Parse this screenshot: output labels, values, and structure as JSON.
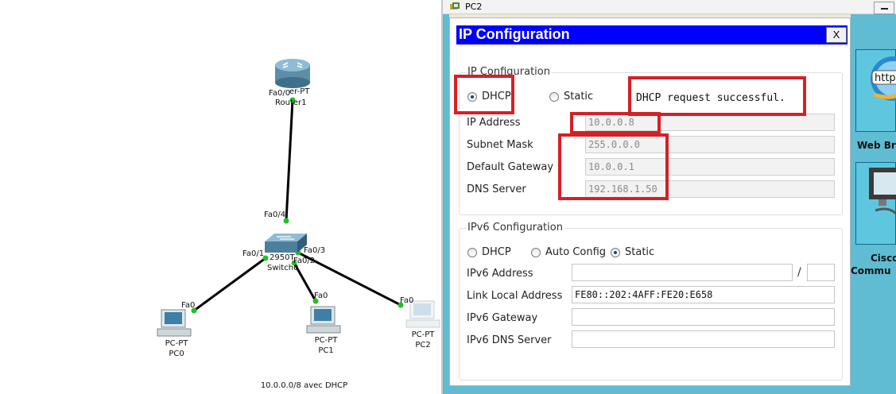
{
  "topology": {
    "caption": "10.0.0.0/8 avec DHCP",
    "router": {
      "model": "er-PT",
      "name": "Router1",
      "port": "Fa0/0"
    },
    "switch": {
      "model": "2950T",
      "name": "Switch0",
      "ports": {
        "to_router": "Fa0/4",
        "to_pc0": "Fa0/1",
        "to_pc1": "Fa0/2",
        "to_pc2": "Fa0/3"
      }
    },
    "pcs": [
      {
        "model": "PC-PT",
        "name": "PC0",
        "port": "Fa0"
      },
      {
        "model": "PC-PT",
        "name": "PC1",
        "port": "Fa0"
      },
      {
        "model": "PC-PT",
        "name": "PC2",
        "port": "Fa0"
      }
    ]
  },
  "window": {
    "title": "PC2"
  },
  "desktop_apps": [
    {
      "label": "Web Br",
      "icon": "web-browser-icon",
      "icon_text": "http"
    },
    {
      "label_line1": "Cisco",
      "label_line2": "Commu",
      "icon": "computer-monitor-icon"
    }
  ],
  "dialog": {
    "title": "IP Configuration",
    "close_label": "X",
    "ipv4": {
      "legend": "IP Configuration",
      "mode_dhcp": "DHCP",
      "mode_static": "Static",
      "selected_mode": "DHCP",
      "status": "DHCP request successful.",
      "fields": [
        {
          "label": "IP Address",
          "value": "10.0.0.8"
        },
        {
          "label": "Subnet Mask",
          "value": "255.0.0.0"
        },
        {
          "label": "Default Gateway",
          "value": "10.0.0.1"
        },
        {
          "label": "DNS Server",
          "value": "192.168.1.50"
        }
      ]
    },
    "ipv6": {
      "legend": "IPv6 Configuration",
      "mode_dhcp": "DHCP",
      "mode_auto": "Auto Config",
      "mode_static": "Static",
      "selected_mode": "Static",
      "address_label": "IPv6 Address",
      "address_value": "",
      "prefix_separator": "/",
      "prefix_value": "",
      "link_local_label": "Link Local Address",
      "link_local_value": "FE80::202:4AFF:FE20:E658",
      "gateway_label": "IPv6 Gateway",
      "gateway_value": "",
      "dns_label": "IPv6 DNS Server",
      "dns_value": ""
    }
  },
  "colors": {
    "dialog_title_bg": "#0000ff",
    "annotation_red": "#d42027",
    "link_up_green": "#1ec41e",
    "desktop_teal": "#5fbcd3"
  }
}
